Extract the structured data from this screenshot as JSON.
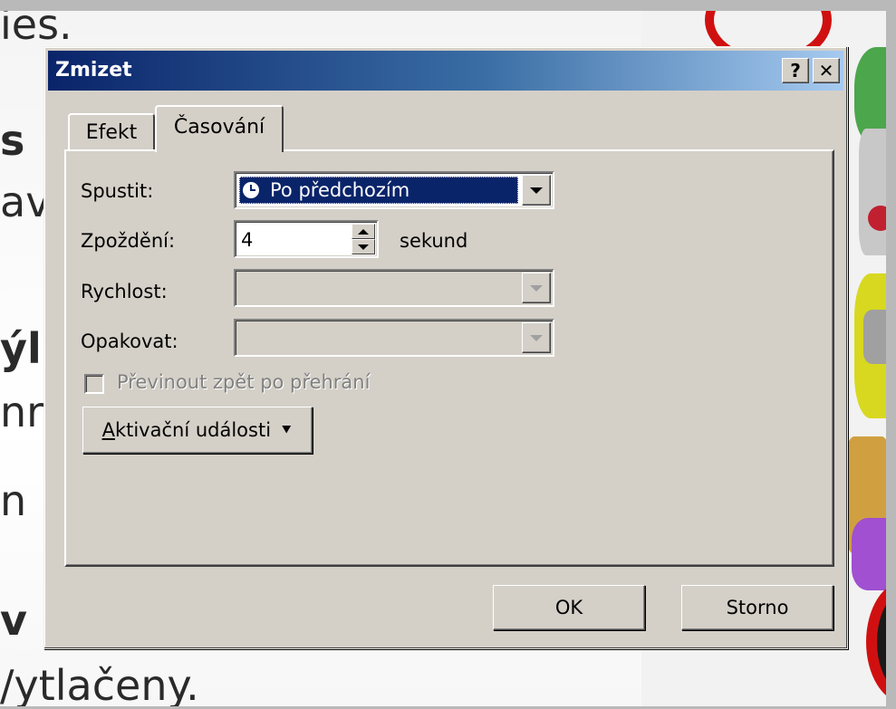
{
  "slide": {
    "lines": [
      {
        "text": "ies.",
        "bold": false
      },
      {
        "text": "s",
        "bold": true
      },
      {
        "text": "av",
        "bold": false
      },
      {
        "text": "ýl",
        "bold": true
      },
      {
        "text": "nr",
        "bold": false
      },
      {
        "text": "n",
        "bold": false
      },
      {
        "text": "v",
        "bold": true
      },
      {
        "text": "/ytlačeny.",
        "bold": false
      }
    ]
  },
  "dialog": {
    "title": "Zmizet",
    "help_label": "?",
    "close_label": "✕",
    "tabs": [
      {
        "label": "Efekt",
        "active": false
      },
      {
        "label": "Časování",
        "active": true
      }
    ],
    "start_label": "Spustit:",
    "start_value": "Po předchozím",
    "delay_label": "Zpoždění:",
    "delay_value": "4",
    "delay_unit": "sekund",
    "speed_label": "Rychlost:",
    "speed_value": "",
    "repeat_label": "Opakovat:",
    "repeat_value": "",
    "rewind_label": "Převinout zpět po přehrání",
    "triggers_prefix": "A",
    "triggers_rest": "ktivační události",
    "triggers_arrow": "⯆",
    "ok_label": "OK",
    "cancel_label": "Storno"
  }
}
